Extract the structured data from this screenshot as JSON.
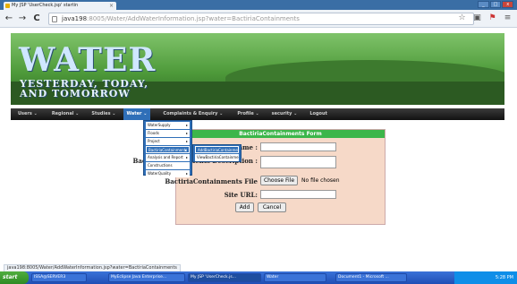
{
  "browser": {
    "tab_title": "My JSP 'UserCheck.jsp' startin",
    "tab_close": "×",
    "url_host": "java198",
    "url_rest": ":8005/Water/AddWaterInformation.jsp?water=BactiriaContainments",
    "back": "←",
    "forward": "→",
    "reload": "C",
    "win_min": "_",
    "win_max": "□",
    "win_close": "x"
  },
  "site": {
    "title": "WATER",
    "tagline_line1": "YESTERDAY, TODAY,",
    "tagline_line2": "AND TOMORROW"
  },
  "menu": [
    {
      "label": "Users ⌄"
    },
    {
      "label": "Regional ⌄"
    },
    {
      "label": "Studies ⌄"
    },
    {
      "label": "Water ⌄"
    },
    {
      "label": "Complaints & Enquiry ⌄"
    },
    {
      "label": "Profile ⌄"
    },
    {
      "label": "security ⌄"
    },
    {
      "label": "Logout"
    }
  ],
  "dropdown": [
    {
      "label": "WaterSupply",
      "arrow": "▸"
    },
    {
      "label": "Floods",
      "arrow": "▸"
    },
    {
      "label": "Project",
      "arrow": "▸"
    },
    {
      "label": "BactiriaContainments",
      "arrow": "▸"
    },
    {
      "label": "Analysis and Report",
      "arrow": "▸"
    },
    {
      "label": "Constructions",
      "arrow": ""
    },
    {
      "label": "WaterQuality",
      "arrow": "▸"
    }
  ],
  "submenu": [
    {
      "label": "AddBactiriaContainments"
    },
    {
      "label": "ViewBactiriaContainments"
    }
  ],
  "form": {
    "heading": "BactiriaContainments Form",
    "name_label": "BactiriaContainments Name :",
    "description_label": "BactiriaContainments Description :",
    "file_label": "BactiriaContainments File",
    "file_button": "Choose File",
    "file_status": "No file chosen",
    "site_label": "Site URL:",
    "add_button": "Add",
    "cancel_button": "Cancel"
  },
  "status_url": "java198:8005/Water/AddWaterInformation.jsp?water=BactiriaContainments",
  "taskbar": {
    "start": "start",
    "tasks": [
      {
        "label": "ISSA@SERVER3"
      },
      {
        "label": "MyEclipse Java Enterprise..."
      },
      {
        "label": "My JSP 'UserCheck.js..."
      },
      {
        "label": "Water"
      },
      {
        "label": "Document1 - Microsoft ..."
      }
    ],
    "clock": "5:28 PM"
  }
}
